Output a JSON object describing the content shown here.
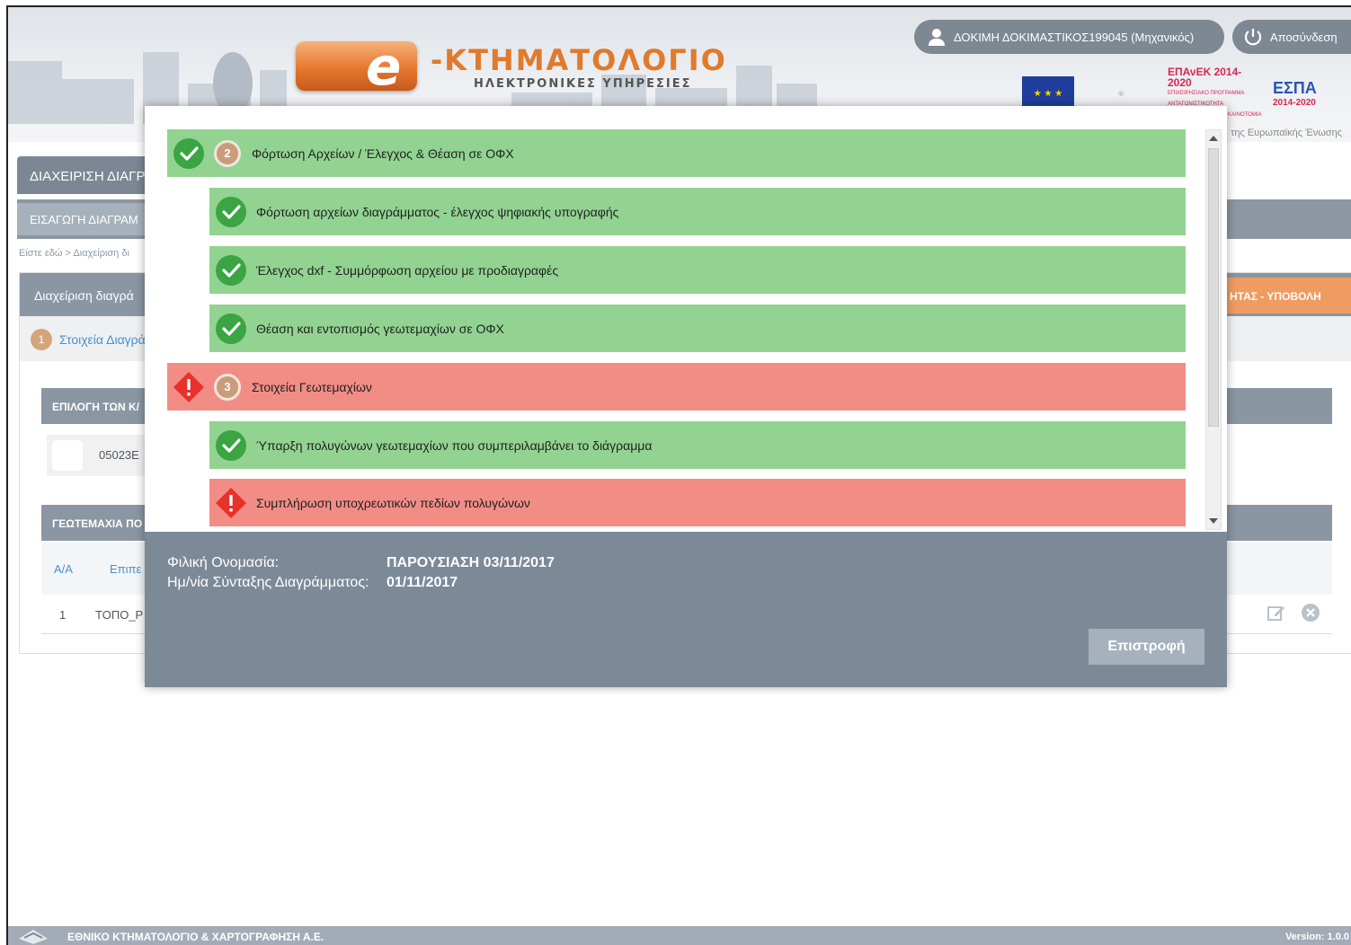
{
  "header": {
    "logo_letter": "e",
    "logo_title": "-ΚΤΗΜΑΤΟΛΟΓΙΟ",
    "logo_subtitle": "ΗΛΕΚΤΡΟΝΙΚΕΣ ΥΠΗΡΕΣΙΕΣ",
    "user_label": "ΔΟΚΙΜΗ ΔΟΚΙΜΑΣΤΙΚΟΣ199045 (Μηχανικός)",
    "logout_label": "Αποσύνδεση",
    "epanek": "ΕΠΑνΕΚ 2014-2020",
    "epanek_sub": "ΕΠΙΧΕΙΡΗΣΙΑΚΟ ΠΡΟΓΡΑΜΜΑ ΑΝΤΑΓΩΝΙΣΤΙΚΟΤΗΤΑ ΕΠΙΧΕΙΡΗΜΑΤΙΚΟΤΗΤΑ ΚΑΙΝΟΤΟΜΙΑ",
    "espa": "ΕΣΠΑ",
    "espa_years": "2014-2020",
    "eu_caption": "της Ευρωπαϊκής Ένωσης"
  },
  "page": {
    "tab_main": "ΔΙΑΧΕΙΡΙΣΗ ΔΙΑΓΡ",
    "tab_sub": "ΕΙΣΑΓΩΓΗ ΔΙΑΓΡΑΜ",
    "breadcrumb": "Είστε εδώ > Διαχείριση δι",
    "panel_title": "Διαχείριση διαγρά",
    "orange_button": "ΗΤΑΣ - ΥΠΟΒΟΛΗ",
    "step_num": "1",
    "step_link": "Στοιχεία Διαγρά",
    "section1": "ΕΠΙΛΟΓΗ ΤΩΝ Κ/",
    "checkbox_label": "05023Ε",
    "section2": "ΓΕΩΤΕΜΑΧΙΑ ΠΟ",
    "th_aa": "Α/Α",
    "th_epip": "Επιπε",
    "td_num": "1",
    "td_topo": "ΤΟΠΟ_Ρ"
  },
  "modal": {
    "items": [
      {
        "status": "ok",
        "level": "main",
        "num": "2",
        "text": "Φόρτωση Αρχείων / Έλεγχος & Θέαση σε ΟΦΧ"
      },
      {
        "status": "ok",
        "level": "sub",
        "text": "Φόρτωση αρχείων διαγράμματος - έλεγχος ψηφιακής υπογραφής"
      },
      {
        "status": "ok",
        "level": "sub",
        "text": "Έλεγχος dxf - Συμμόρφωση αρχείου με προδιαγραφές"
      },
      {
        "status": "ok",
        "level": "sub",
        "text": "Θέαση και εντοπισμός γεωτεμαχίων σε ΟΦΧ"
      },
      {
        "status": "err",
        "level": "main",
        "num": "3",
        "text": "Στοιχεία Γεωτεμαχίων"
      },
      {
        "status": "ok",
        "level": "sub",
        "text": "Ύπαρξη πολυγώνων γεωτεμαχίων που συμπεριλαμβάνει το διάγραμμα"
      },
      {
        "status": "err",
        "level": "sub",
        "text": "Συμπλήρωση υποχρεωτικών πεδίων πολυγώνων"
      }
    ],
    "friendly_name_label": "Φιλική Ονομασία:",
    "friendly_name_value": "ΠΑΡΟΥΣΙΑΣΗ 03/11/2017",
    "date_label": "Ημ/νία Σύνταξης Διαγράμματος:",
    "date_value": "01/11/2017",
    "return_button": "Επιστροφή"
  },
  "footer": {
    "org_name": "ΕΘΝΙΚΟ ΚΤΗΜΑΤΟΛΟΓΙΟ & ΧΑΡΤΟΓΡΑΦΗΣΗ Α.Ε.",
    "version": "Version: 1.0.0"
  },
  "colors": {
    "ok": "#92d391",
    "error": "#f28d86",
    "header_pill": "#7d8893",
    "modal_footer": "#7c8a97",
    "accent_orange": "#ef9c63"
  }
}
